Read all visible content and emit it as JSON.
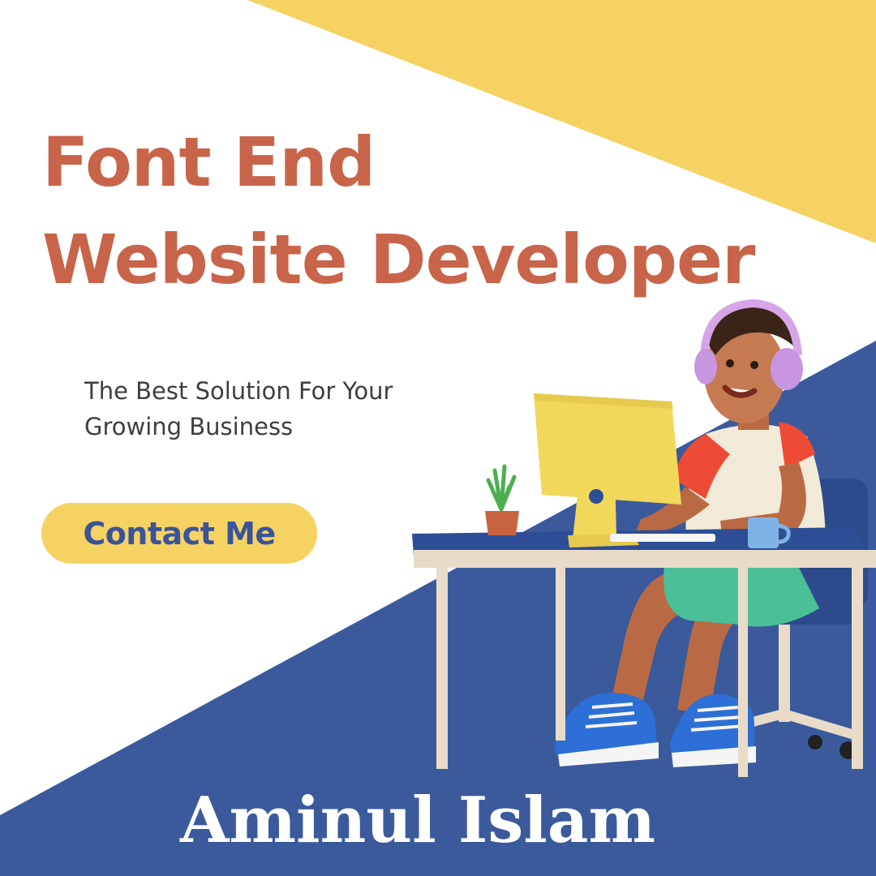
{
  "headline": {
    "line1": "Font End",
    "line2": "Website Developer"
  },
  "subtitle": {
    "line1": "The Best Solution For Your",
    "line2": "Growing Business"
  },
  "cta": {
    "label": "Contact Me"
  },
  "name": "Aminul Islam",
  "colors": {
    "yellow": "#f6d262",
    "blue": "#3a5a9c",
    "headline": "#c8644a",
    "button_text": "#3a5499",
    "background": "#ffffff"
  },
  "illustration": {
    "icon": "developer-at-desk-icon"
  }
}
